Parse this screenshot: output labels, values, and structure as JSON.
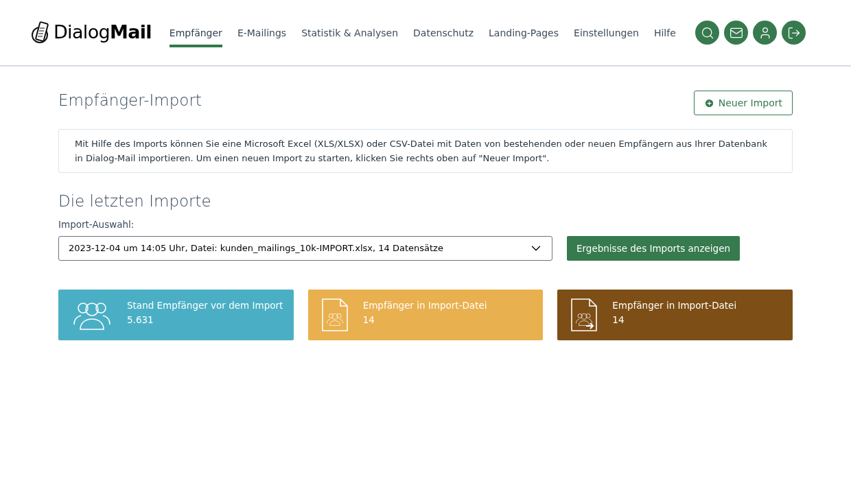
{
  "logo": {
    "text": "Dialog**Mail**"
  },
  "nav": [
    {
      "label": "Empfänger",
      "selected": true
    },
    {
      "label": "E-Mailings",
      "selected": false
    },
    {
      "label": "Statistik & Analysen",
      "selected": false
    },
    {
      "label": "Datenschutz",
      "selected": false
    },
    {
      "label": "Landing-Pages",
      "selected": false
    },
    {
      "label": "Einstellungen",
      "selected": false
    },
    {
      "label": "Hilfe",
      "selected": false
    }
  ],
  "page_title": "Empfänger-Import",
  "new_import_button": "Neuer Import",
  "info_text": "Mit Hilfe des Imports können Sie eine Microsoft Excel (XLS/XLSX) oder CSV-Datei mit Daten von bestehenden oder neuen Empfängern aus Ihrer Datenbank in Dialog-Mail importieren. Um einen neuen Import zu starten, klicken Sie rechts oben auf \"Neuer Import\".",
  "section_title": "Die letzten Importe",
  "import_select": {
    "label": "Import-Auswahl:",
    "value": "2023-12-04 um 14:05 Uhr, Datei: kunden_mailings_10k-IMPORT.xlsx, 14 Datensätze"
  },
  "show_results_button": "Ergebnisse des Imports anzeigen",
  "cards": [
    {
      "kind": "people",
      "color": "#4aafc5",
      "label": "Stand Empfänger vor dem Import",
      "value": "5.631"
    },
    {
      "kind": "file",
      "color": "#e9b04f",
      "label": "Empfänger in Import-Datei",
      "value": "14"
    },
    {
      "kind": "file-export",
      "color": "#7d4e15",
      "label": "Empfänger in Import-Datei",
      "value": "14"
    }
  ]
}
